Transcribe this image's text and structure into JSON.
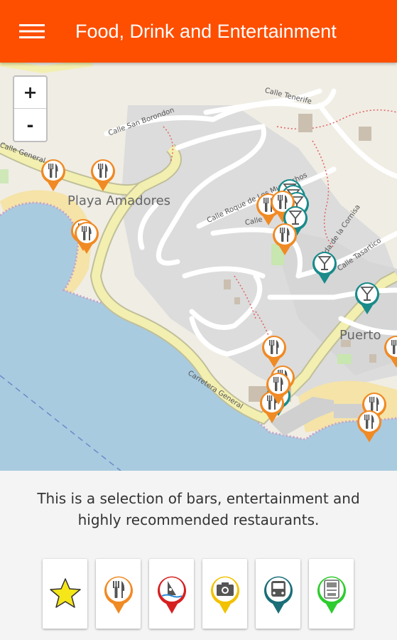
{
  "app_bar": {
    "title": "Food, Drink and Entertainment",
    "menu_icon": "hamburger-menu-icon",
    "color": "#fe4e00"
  },
  "map": {
    "zoom_in": "+",
    "zoom_out": "-",
    "labels": {
      "playa_amadores": "Playa Amadores",
      "puerto": "Puerto",
      "calle_tenerife": "Calle Tenerife",
      "calle_san_borondon": "Calle San Borondon",
      "calle_general": "Calle General",
      "carretera_general": "Carretera General",
      "calle_roque": "Calle Roque de Los Muchachos",
      "calle_la_cornisa": "Avenida de la Cornisa",
      "calle_tasartico": "Calle Tasartico",
      "calle_short": "Calle"
    },
    "markers": {
      "restaurant": {
        "icon": "fork-knife-icon",
        "color": "#f08a24"
      },
      "bar": {
        "icon": "cocktail-glass-icon",
        "color": "#1a8a8a"
      }
    }
  },
  "description": {
    "line1": "This is a selection of bars, entertainment and",
    "line2": "highly recommended restaurants."
  },
  "categories": [
    {
      "name": "favorites",
      "icon": "star-icon",
      "color": "#f5e61a"
    },
    {
      "name": "restaurants",
      "icon": "fork-knife-icon",
      "color": "#f08a24"
    },
    {
      "name": "water-sports",
      "icon": "windsurf-icon",
      "color": "#d62020"
    },
    {
      "name": "sightseeing",
      "icon": "camera-icon",
      "color": "#f2c200"
    },
    {
      "name": "transport",
      "icon": "bus-icon",
      "color": "#1a6e78"
    },
    {
      "name": "atm",
      "icon": "atm-icon",
      "color": "#2ecc2e"
    }
  ]
}
